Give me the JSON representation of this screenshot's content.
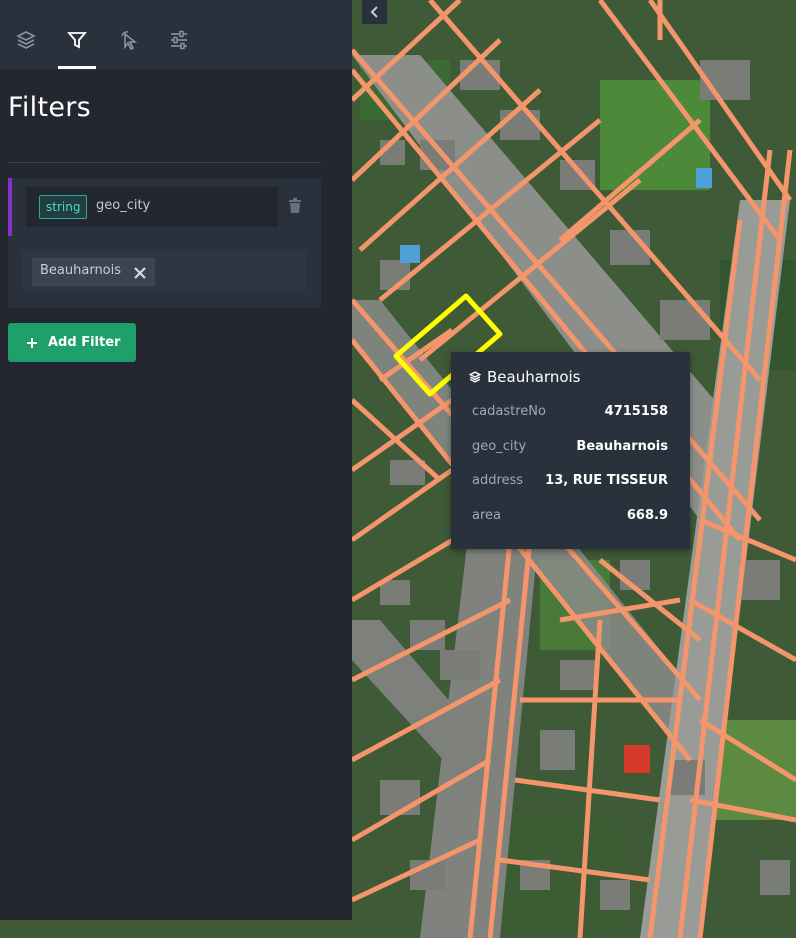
{
  "sidebar": {
    "tabs": [
      {
        "icon": "layers-icon"
      },
      {
        "icon": "filter-icon",
        "active": true
      },
      {
        "icon": "interaction-icon"
      },
      {
        "icon": "settings-sliders-icon"
      }
    ],
    "title": "Filters",
    "filter": {
      "type_label": "string",
      "field_name": "geo_city",
      "value_chip": "Beauharnois",
      "accent_color": "#8b2fc9"
    },
    "add_filter_label": "Add Filter"
  },
  "tooltip": {
    "layer_name": "Beauharnois",
    "rows": [
      {
        "key": "cadastreNo",
        "value": "4715158"
      },
      {
        "key": "geo_city",
        "value": "Beauharnois"
      },
      {
        "key": "address",
        "value": "13, RUE TISSEUR"
      },
      {
        "key": "area",
        "value": "668.9"
      }
    ]
  },
  "map": {
    "parcel_color": "#f4956b",
    "highlight_color": "#ffff00"
  }
}
